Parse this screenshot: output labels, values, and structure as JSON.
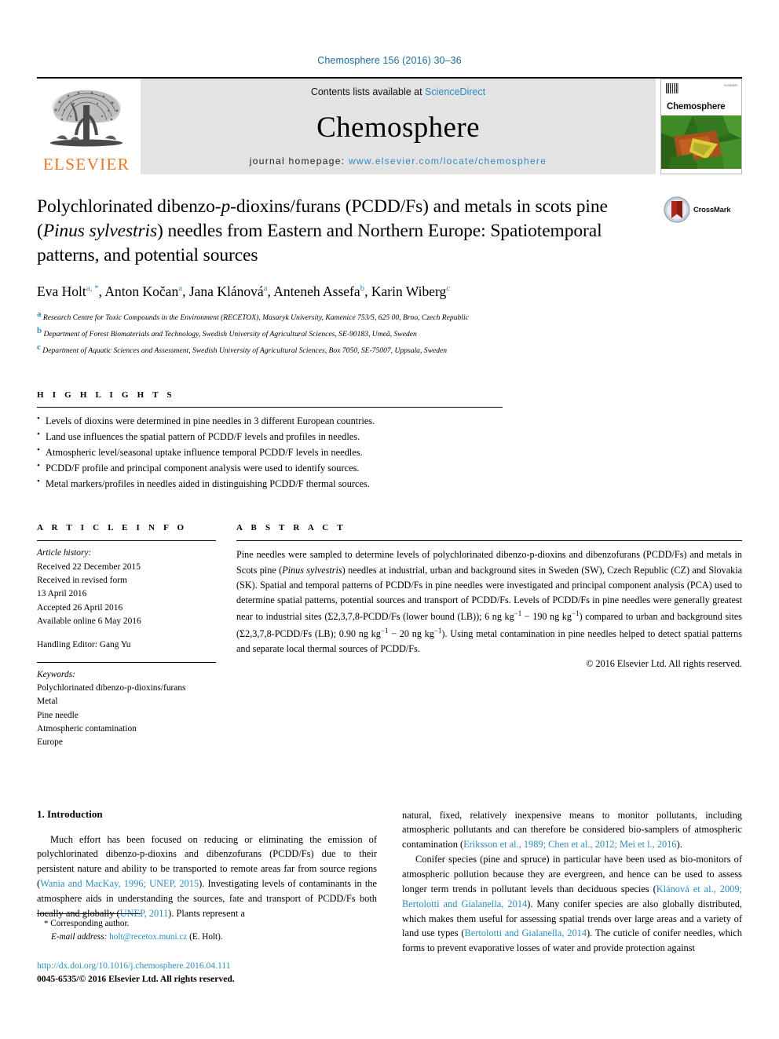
{
  "running_head": "Chemosphere 156 (2016) 30–36",
  "header": {
    "contents_prefix": "Contents lists available at ",
    "sciencedirect": "ScienceDirect",
    "journal_name": "Chemosphere",
    "homepage_prefix": "journal homepage: ",
    "homepage_url": "www.elsevier.com/locate/chemosphere",
    "publisher_logo_text": "ELSEVIER",
    "publisher_logo_icon": "elsevier-tree-icon",
    "cover": {
      "title": "Chemosphere",
      "corner_text": "ELSEVIER",
      "barcode_icon": "barcode-icon"
    }
  },
  "title": {
    "line1_a": "Polychlorinated dibenzo-",
    "line1_ital": "p",
    "line1_b": "-dioxins/furans (PCDD/Fs) and metals in",
    "line2_a": "scots pine (",
    "line2_ital": "Pinus sylvestris",
    "line2_b": ") needles from Eastern and Northern",
    "line3": "Europe: Spatiotemporal patterns, and potential sources",
    "full": "Polychlorinated dibenzo-p-dioxins/furans (PCDD/Fs) and metals in scots pine (Pinus sylvestris) needles from Eastern and Northern Europe: Spatiotemporal patterns, and potential sources"
  },
  "crossmark": {
    "label": "CrossMark",
    "icon": "crossmark-icon"
  },
  "authors": [
    {
      "name": "Eva Holt",
      "sup": "a, *"
    },
    {
      "name": "Anton Kočan",
      "sup": "a"
    },
    {
      "name": "Jana Klánová",
      "sup": "a"
    },
    {
      "name": "Anteneh Assefa",
      "sup": "b"
    },
    {
      "name": "Karin Wiberg",
      "sup": "c"
    }
  ],
  "affiliations": [
    {
      "mark": "a",
      "text": "Research Centre for Toxic Compounds in the Environment (RECETOX), Masaryk University, Kamenice 753/5, 625 00, Brno, Czech Republic"
    },
    {
      "mark": "b",
      "text": "Department of Forest Biomaterials and Technology, Swedish University of Agricultural Sciences, SE-90183, Umeå, Sweden"
    },
    {
      "mark": "c",
      "text": "Department of Aquatic Sciences and Assessment, Swedish University of Agricultural Sciences, Box 7050, SE-75007, Uppsala, Sweden"
    }
  ],
  "highlights": {
    "label": "H I G H L I G H T S",
    "items": [
      "Levels of dioxins were determined in pine needles in 3 different European countries.",
      "Land use influences the spatial pattern of PCDD/F levels and profiles in needles.",
      "Atmospheric level/seasonal uptake influence temporal PCDD/F levels in needles.",
      "PCDD/F profile and principal component analysis were used to identify sources.",
      "Metal markers/profiles in needles aided in distinguishing PCDD/F thermal sources."
    ]
  },
  "article_info": {
    "label": "A R T I C L E  I N F O",
    "history_label": "Article history:",
    "history": [
      "Received 22 December 2015",
      "Received in revised form",
      "13 April 2016",
      "Accepted 26 April 2016",
      "Available online 6 May 2016"
    ],
    "handling_editor": "Handling Editor: Gang Yu",
    "keywords_label": "Keywords:",
    "keywords": [
      "Polychlorinated dibenzo-p-dioxins/furans",
      "Metal",
      "Pine needle",
      "Atmospheric contamination",
      "Europe"
    ]
  },
  "abstract": {
    "label": "A B S T R A C T",
    "part1": "Pine needles were sampled to determine levels of polychlorinated dibenzo-p-dioxins and dibenzofurans (PCDD/Fs) and metals in Scots pine (",
    "species": "Pinus sylvestris",
    "part2": ") needles at industrial, urban and background sites in Sweden (SW), Czech Republic (CZ) and Slovakia (SK). Spatial and temporal patterns of PCDD/Fs in pine needles were investigated and principal component analysis (PCA) used to determine spatial patterns, potential sources and transport of PCDD/Fs. Levels of PCDD/Fs in pine needles were generally greatest near to industrial sites (Σ2,3,7,8-PCDD/Fs (lower bound (LB)); 6 ng kg",
    "exp1": "−1",
    "part3": " − 190 ng kg",
    "exp2": "−1",
    "part4": ") compared to urban and background sites (Σ2,3,7,8-PCDD/Fs (LB); 0.90 ng kg",
    "exp3": "−1",
    "part5": " − 20 ng kg",
    "exp4": "−1",
    "part6": "). Using metal contamination in pine needles helped to detect spatial patterns and separate local thermal sources of PCDD/Fs.",
    "copyright": "© 2016 Elsevier Ltd. All rights reserved."
  },
  "body": {
    "section_number_title": "1. Introduction",
    "left_paragraph_1": {
      "t1": "Much effort has been focused on reducing or eliminating the emission of polychlorinated dibenzo-p-dioxins and dibenzofurans (PCDD/Fs) due to their persistent nature and ability to be transported to remote areas far from source regions (",
      "c1": "Wania and MacKay, 1996; UNEP, 2015",
      "t2": "). Investigating levels of contaminants in the atmosphere aids in understanding the sources, fate and transport of PCDD/Fs both locally and globally (",
      "c2": "UNEP, 2011",
      "t3": "). Plants represent a"
    },
    "right_paragraph_1": {
      "t1": "natural, fixed, relatively inexpensive means to monitor pollutants, including atmospheric pollutants and can therefore be considered bio-samplers of atmospheric contamination (",
      "c1": "Eriksson et al., 1989; Chen et al., 2012; Mei et l., 2016",
      "t2": ")."
    },
    "right_paragraph_2": {
      "t1": "Conifer species (pine and spruce) in particular have been used as bio-monitors of atmospheric pollution because they are evergreen, and hence can be used to assess longer term trends in pollutant levels than deciduous species (",
      "c1": "Klánová et al., 2009; Bertolotti and Gialanella, 2014",
      "t2": "). Many conifer species are also globally distributed, which makes them useful for assessing spatial trends over large areas and a variety of land use types (",
      "c2": "Bertolotti and Gialanella, 2014",
      "t3": "). The cuticle of conifer needles, which forms to prevent evaporative losses of water and provide protection against"
    }
  },
  "footnote": {
    "star": "*",
    "corresponding": "Corresponding author.",
    "email_label": "E-mail address:",
    "email": "holt@recetox.muni.cz",
    "email_owner": "(E. Holt)."
  },
  "footer": {
    "doi": "http://dx.doi.org/10.1016/j.chemosphere.2016.04.111",
    "issn_line": "0045-6535/© 2016 Elsevier Ltd. All rights reserved."
  },
  "colors": {
    "link_blue": "#2b8cbe",
    "elsevier_orange": "#e87722",
    "band_grey": "#e3e3e3",
    "crossmark_red": "#b5241f"
  }
}
